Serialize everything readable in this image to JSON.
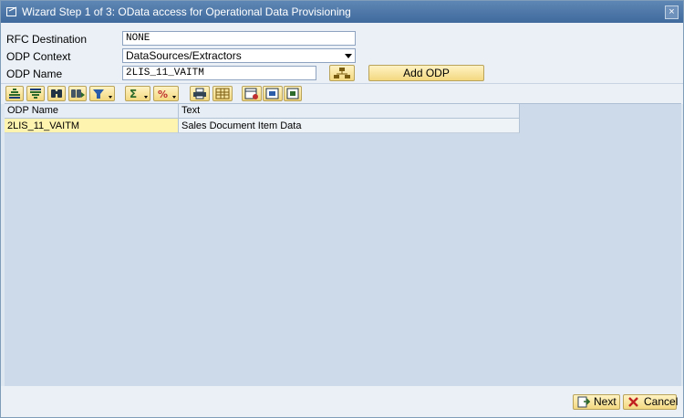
{
  "window": {
    "title": "Wizard Step 1 of 3: OData access for Operational Data Provisioning",
    "close_glyph": "×"
  },
  "form": {
    "rfc_label": "RFC Destination",
    "rfc_value": "NONE",
    "context_label": "ODP Context",
    "context_value": "DataSources/Extractors",
    "name_label": "ODP Name",
    "name_value": "2LIS_11_VAITM",
    "hierarchy_button": "hierarchy-icon",
    "add_button_label": "Add ODP"
  },
  "toolbar": {
    "icons": [
      "sort-ascending-icon",
      "sort-descending-icon",
      "find-icon",
      "find-next-icon",
      "filter-icon",
      "sum-icon",
      "subtotal-icon",
      "print-icon",
      "export-icon",
      "layout-icon",
      "select-layout-icon",
      "save-layout-icon"
    ]
  },
  "grid": {
    "columns": [
      "ODP Name",
      "Text"
    ],
    "rows": [
      [
        "2LIS_11_VAITM",
        "Sales Document Item Data"
      ]
    ],
    "selected_color": "#fff3b0"
  },
  "footer": {
    "next_label": "Next",
    "cancel_label": "Cancel"
  }
}
